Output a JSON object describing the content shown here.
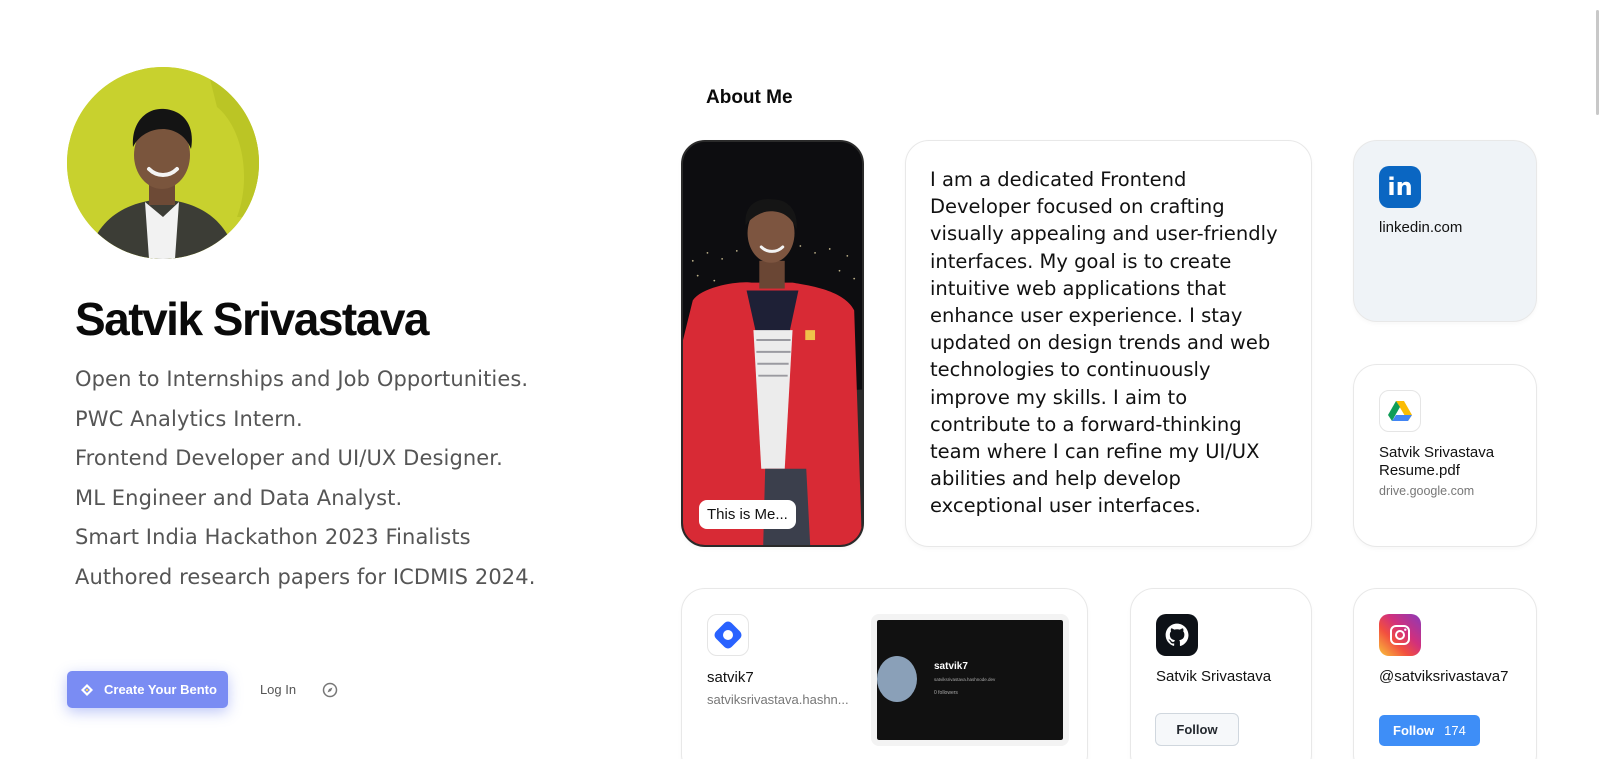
{
  "profile": {
    "name": "Satvik Srivastava",
    "bio": [
      "Open to Internships and Job Opportunities.",
      "PWC Analytics Intern.",
      "Frontend Developer and UI/UX Designer.",
      "ML Engineer and Data Analyst.",
      "Smart India Hackathon 2023 Finalists",
      "Authored research papers for ICDMIS 2024."
    ]
  },
  "footer": {
    "create_label": "Create Your Bento",
    "login_label": "Log In"
  },
  "about": {
    "title": "About Me",
    "photo_caption": "This is Me...",
    "description": "I am a dedicated Frontend Developer focused on crafting visually appealing and user-friendly interfaces. My goal is to create intuitive web applications that enhance user experience. I stay updated on design trends and web technologies to continuously improve my skills. I aim to contribute to a forward-thinking team where I can refine my UI/UX abilities and help develop exceptional user interfaces."
  },
  "cards": {
    "linkedin": {
      "label": "linkedin.com",
      "icon": "linkedin-icon",
      "color": "#0a66c2"
    },
    "resume": {
      "title": "Satvik Srivastava Resume.pdf",
      "domain": "drive.google.com",
      "icon": "google-drive-icon"
    },
    "hashnode": {
      "title": "satvik7",
      "domain": "satviksrivastava.hashn...",
      "icon": "hashnode-icon",
      "color": "#2962ff",
      "preview_title": "satvik7",
      "preview_sub": "satviksrivastava.hashnode.dev",
      "preview_followers": "0 followers"
    },
    "github": {
      "title": "Satvik Srivastava",
      "follow_label": "Follow",
      "icon": "github-icon"
    },
    "instagram": {
      "handle": "@satviksrivastava7",
      "follow_label": "Follow",
      "follow_count": "174",
      "icon": "instagram-icon",
      "color": "#3e8ef7"
    }
  }
}
